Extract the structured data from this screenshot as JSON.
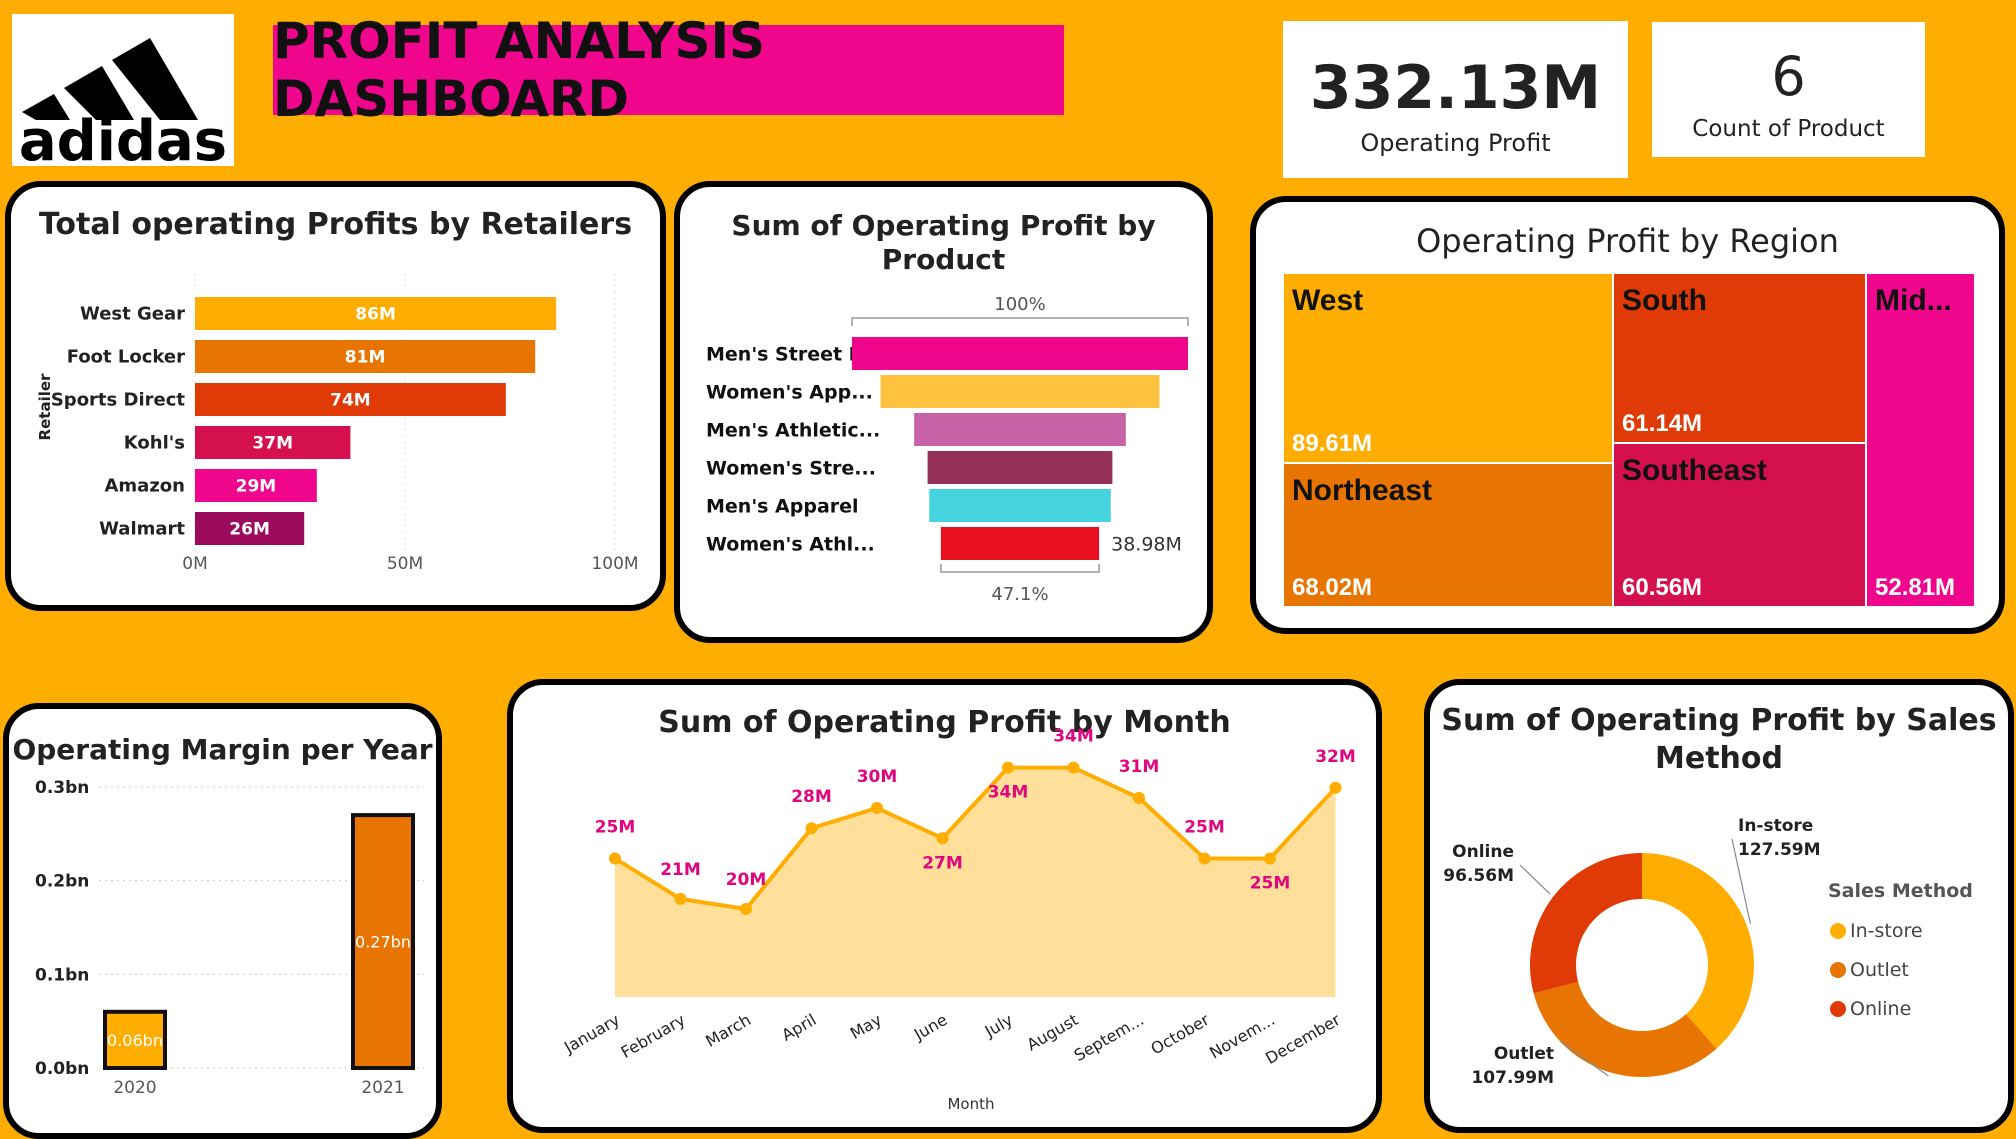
{
  "header": {
    "logo_text": "adidas",
    "title": "PROFIT ANALYSIS DASHBOARD"
  },
  "kpis": {
    "operating_profit": {
      "value": "332.13M",
      "label": "Operating Profit"
    },
    "count_of_product": {
      "value": "6",
      "label": "Count of Product"
    }
  },
  "retailers_chart": {
    "title": "Total operating Profits by Retailers",
    "ylabel": "Retailer",
    "xticks": [
      "0M",
      "50M",
      "100M"
    ],
    "bars": [
      {
        "name": "West Gear",
        "value": 86,
        "label": "86M",
        "color": "#FFAE01"
      },
      {
        "name": "Foot Locker",
        "value": 81,
        "label": "81M",
        "color": "#E87502"
      },
      {
        "name": "Sports Direct",
        "value": 74,
        "label": "74M",
        "color": "#E03A06"
      },
      {
        "name": "Kohl's",
        "value": 37,
        "label": "37M",
        "color": "#D4104F"
      },
      {
        "name": "Amazon",
        "value": 29,
        "label": "29M",
        "color": "#F0068C"
      },
      {
        "name": "Walmart",
        "value": 26,
        "label": "26M",
        "color": "#9C0A5C"
      }
    ]
  },
  "product_chart": {
    "title_line1": "Sum of Operating Profit by",
    "title_line2": "Product",
    "top_pct": "100%",
    "bottom_pct": "47.1%",
    "last_value": "38.98M",
    "rows": [
      {
        "name": "Men's Street F...",
        "value": 100,
        "color": "#F0068C"
      },
      {
        "name": "Women's App...",
        "value": 83,
        "color": "#FFC23E"
      },
      {
        "name": "Men's Athletic...",
        "value": 63,
        "color": "#C762A6"
      },
      {
        "name": "Women's Stre...",
        "value": 55,
        "color": "#953159"
      },
      {
        "name": "Men's Apparel",
        "value": 54,
        "color": "#46D3E0"
      },
      {
        "name": "Women's Athl...",
        "value": 47.1,
        "color": "#E8101E"
      }
    ]
  },
  "region_chart": {
    "title": "Operating Profit by Region",
    "tiles": [
      {
        "name": "West",
        "value": "89.61M",
        "color": "#FFAE01"
      },
      {
        "name": "South",
        "value": "61.14M",
        "color": "#E03A06"
      },
      {
        "name": "Mid...",
        "value": "52.81M",
        "color": "#F0068C"
      },
      {
        "name": "Northeast",
        "value": "68.02M",
        "color": "#E87502"
      },
      {
        "name": "Southeast",
        "value": "60.56M",
        "color": "#D4104F"
      }
    ]
  },
  "margin_chart": {
    "title": "Operating Margin per Year",
    "yticks": [
      "0.3bn",
      "0.2bn",
      "0.1bn",
      "0.0bn"
    ],
    "bars": [
      {
        "year": "2020",
        "value": 0.06,
        "label": "0.06bn",
        "color": "#FFAE01"
      },
      {
        "year": "2021",
        "value": 0.27,
        "label": "0.27bn",
        "color": "#E87502"
      }
    ]
  },
  "month_chart": {
    "title": "Sum of Operating Profit by Month",
    "xlabel": "Month",
    "line_color": "#FFAE01",
    "label_color": "#E0067F",
    "points": [
      {
        "month": "January",
        "value": 25,
        "label": "25M"
      },
      {
        "month": "February",
        "value": 21,
        "label": "21M"
      },
      {
        "month": "March",
        "value": 20,
        "label": "20M"
      },
      {
        "month": "April",
        "value": 28,
        "label": "28M"
      },
      {
        "month": "May",
        "value": 30,
        "label": "30M"
      },
      {
        "month": "June",
        "value": 27,
        "label": "27M"
      },
      {
        "month": "July",
        "value": 34,
        "label": "34M"
      },
      {
        "month": "August",
        "value": 34,
        "label": "34M"
      },
      {
        "month": "Septem...",
        "value": 31,
        "label": "31M"
      },
      {
        "month": "October",
        "value": 25,
        "label": "25M"
      },
      {
        "month": "Novem...",
        "value": 25,
        "label": "25M"
      },
      {
        "month": "December",
        "value": 32,
        "label": "32M"
      }
    ]
  },
  "sales_method_chart": {
    "title_line1": "Sum of Operating Profit by Sales",
    "title_line2": "Method",
    "legend_title": "Sales Method",
    "slices": [
      {
        "name": "In-store",
        "value": 127.59,
        "label": "127.59M",
        "color": "#FFAE01"
      },
      {
        "name": "Outlet",
        "value": 107.99,
        "label": "107.99M",
        "color": "#E87502"
      },
      {
        "name": "Online",
        "value": 96.56,
        "label": "96.56M",
        "color": "#E03A06"
      }
    ]
  }
}
